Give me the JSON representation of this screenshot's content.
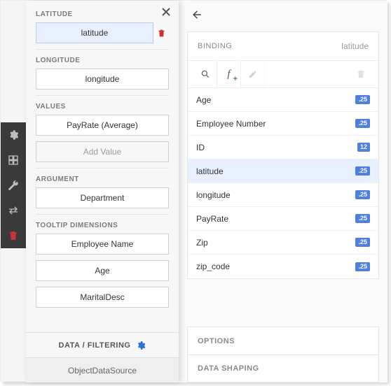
{
  "left": {
    "sections": {
      "latitude": {
        "label": "LATITUDE",
        "value": "latitude"
      },
      "longitude": {
        "label": "LONGITUDE",
        "value": "longitude"
      },
      "values": {
        "label": "VALUES",
        "value": "PayRate (Average)",
        "add": "Add Value"
      },
      "argument": {
        "label": "ARGUMENT",
        "value": "Department"
      },
      "tooltip": {
        "label": "TOOLTIP DIMENSIONS",
        "d1": "Employee Name",
        "d2": "Age",
        "d3": "MaritalDesc"
      }
    },
    "datafilter": "DATA / FILTERING",
    "datasource": "ObjectDataSource"
  },
  "right": {
    "binding_label": "BINDING",
    "binding_value": "latitude",
    "fields": [
      {
        "name": "Age",
        "badge": ".25"
      },
      {
        "name": "Employee Number",
        "badge": ".25"
      },
      {
        "name": "ID",
        "badge": "12"
      },
      {
        "name": "latitude",
        "badge": ".25",
        "selected": true
      },
      {
        "name": "longitude",
        "badge": ".25"
      },
      {
        "name": "PayRate",
        "badge": ".25"
      },
      {
        "name": "Zip",
        "badge": ".25"
      },
      {
        "name": "zip_code",
        "badge": ".25"
      }
    ],
    "options_label": "OPTIONS",
    "shaping_label": "DATA SHAPING"
  }
}
